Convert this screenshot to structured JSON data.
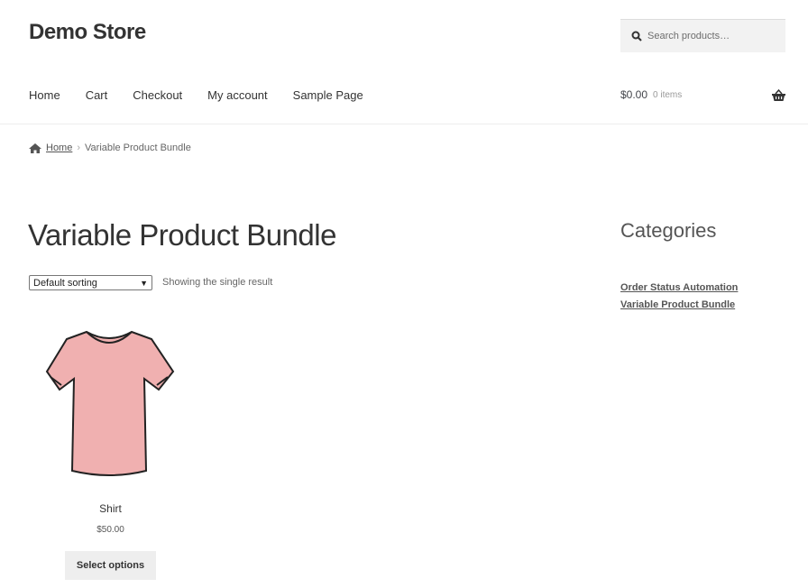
{
  "site": {
    "title": "Demo Store"
  },
  "search": {
    "placeholder": "Search products…"
  },
  "nav": [
    "Home",
    "Cart",
    "Checkout",
    "My account",
    "Sample Page"
  ],
  "cart": {
    "total": "$0.00",
    "items": "0 items"
  },
  "breadcrumb": {
    "home": "Home",
    "separator": "›",
    "current": "Variable Product Bundle"
  },
  "page": {
    "title": "Variable Product Bundle",
    "sorting": "Default sorting",
    "result_count": "Showing the single result"
  },
  "product": {
    "name": "Shirt",
    "price": "$50.00",
    "button": "Select options",
    "color": "#f0b0b0"
  },
  "sidebar": {
    "heading": "Categories",
    "categories": [
      "Order Status Automation",
      "Variable Product Bundle"
    ]
  }
}
